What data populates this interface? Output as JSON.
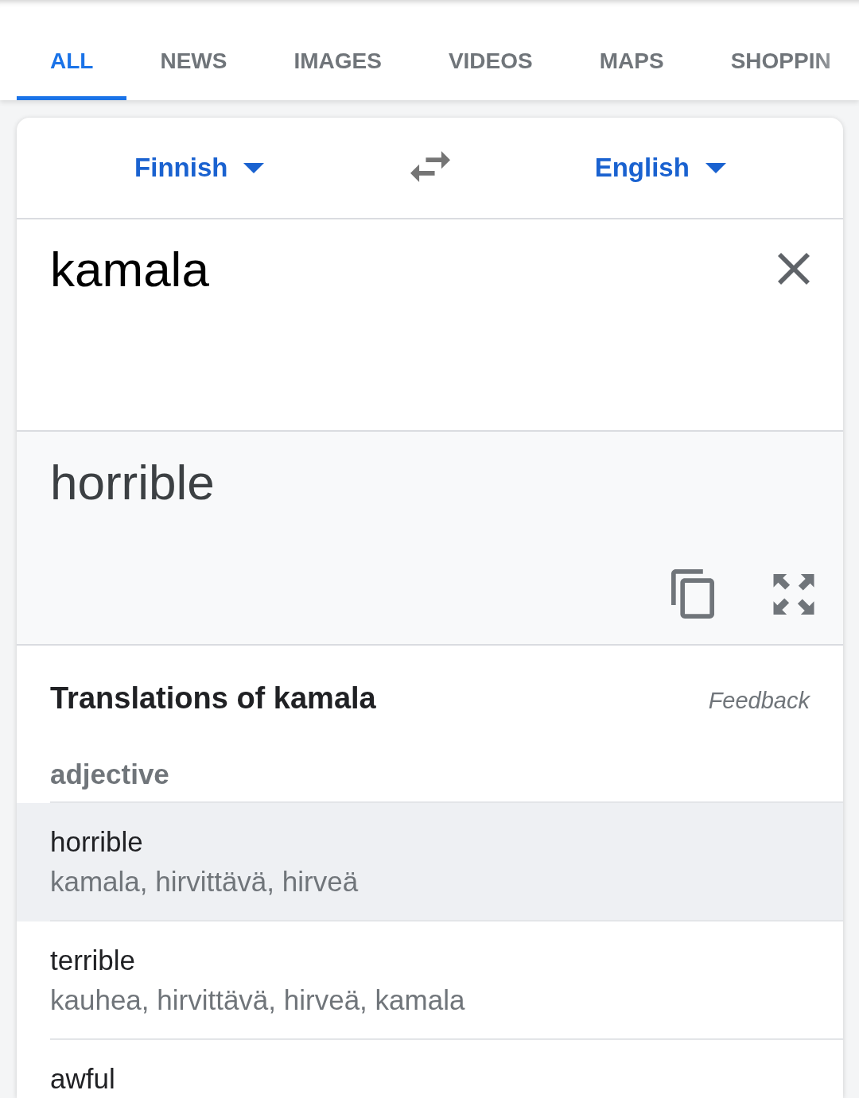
{
  "tabs": [
    {
      "label": "ALL",
      "selected": true
    },
    {
      "label": "NEWS",
      "selected": false
    },
    {
      "label": "IMAGES",
      "selected": false
    },
    {
      "label": "VIDEOS",
      "selected": false
    },
    {
      "label": "MAPS",
      "selected": false
    },
    {
      "label": "SHOPPIN",
      "selected": false
    }
  ],
  "languages": {
    "source": "Finnish",
    "target": "English"
  },
  "source": {
    "text": "kamala"
  },
  "output": {
    "text": "horrible"
  },
  "dictionary": {
    "title": "Translations of kamala",
    "feedback": "Feedback",
    "groups": [
      {
        "part_of_speech": "adjective",
        "entries": [
          {
            "word": "horrible",
            "back_translations": "kamala, hirvittävä, hirveä",
            "selected": true
          },
          {
            "word": "terrible",
            "back_translations": "kauhea, hirvittävä, hirveä, kamala",
            "selected": false
          },
          {
            "word": "awful",
            "selected": false
          }
        ]
      }
    ]
  }
}
